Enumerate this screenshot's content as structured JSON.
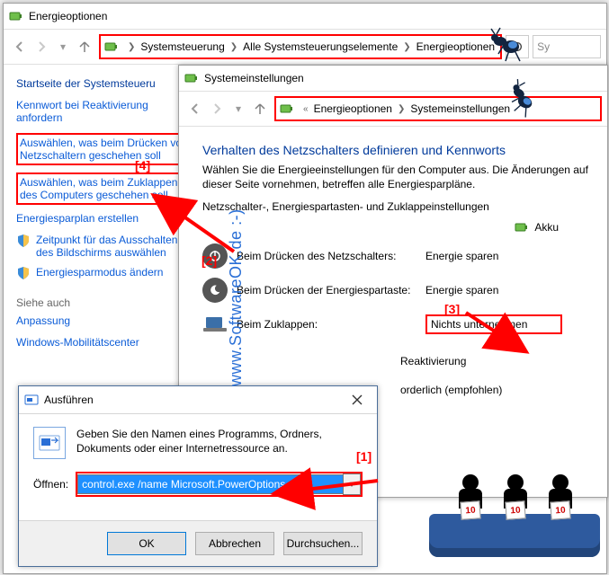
{
  "main_window": {
    "title": "Energieoptionen",
    "breadcrumb": [
      "Systemsteuerung",
      "Alle Systemsteuerungselemente",
      "Energieoptionen"
    ],
    "search_placeholder": "Sy",
    "sidebar": {
      "home": "Startseite der Systemsteueru",
      "items": [
        "Kennwort bei Reaktivierung anfordern",
        "Auswählen, was beim Drücken von Netzschaltern geschehen soll",
        "Auswählen, was beim Zuklappen des Computers geschehen soll",
        "Energiesparplan erstellen",
        "Zeitpunkt für das Ausschalten des Bildschirms auswählen",
        "Energiesparmodus ändern"
      ],
      "see_also_header": "Siehe auch",
      "see_also": [
        "Anpassung",
        "Windows-Mobilitätscenter"
      ]
    }
  },
  "inner_window": {
    "title": "Systemeinstellungen",
    "breadcrumb": [
      "Energieoptionen",
      "Systemeinstellungen"
    ],
    "heading": "Verhalten des Netzschalters definieren und Kennworts",
    "description": "Wählen Sie die Energieeinstellungen für den Computer aus. Die Änderungen auf dieser Seite vornehmen, betreffen alle Energiesparpläne.",
    "subheading": "Netzschalter-, Energiespartasten- und Zuklappeinstellungen",
    "column_label": "Akku",
    "rows": [
      {
        "label": "Beim Drücken des Netzschalters:",
        "value": "Energie sparen"
      },
      {
        "label": "Beim Drücken der Energiespartaste:",
        "value": "Energie sparen"
      },
      {
        "label": "Beim Zuklappen:",
        "value": "Nichts unternehmen"
      }
    ],
    "trailing_lines": [
      "Reaktivierung",
      "orderlich (empfohlen)"
    ]
  },
  "run_dialog": {
    "title": "Ausführen",
    "description": "Geben Sie den Namen eines Programms, Ordners, Dokuments oder einer Internetressource an.",
    "open_label": "Öffnen:",
    "command": "control.exe /name Microsoft.PowerOptions",
    "buttons": {
      "ok": "OK",
      "cancel": "Abbrechen",
      "browse": "Durchsuchen..."
    }
  },
  "annotations": {
    "1": "[1]",
    "2": "[2]",
    "3": "[3]",
    "4": "[4]"
  },
  "watermark": "www.SoftwareOK.de :-)",
  "judge_score": "10"
}
